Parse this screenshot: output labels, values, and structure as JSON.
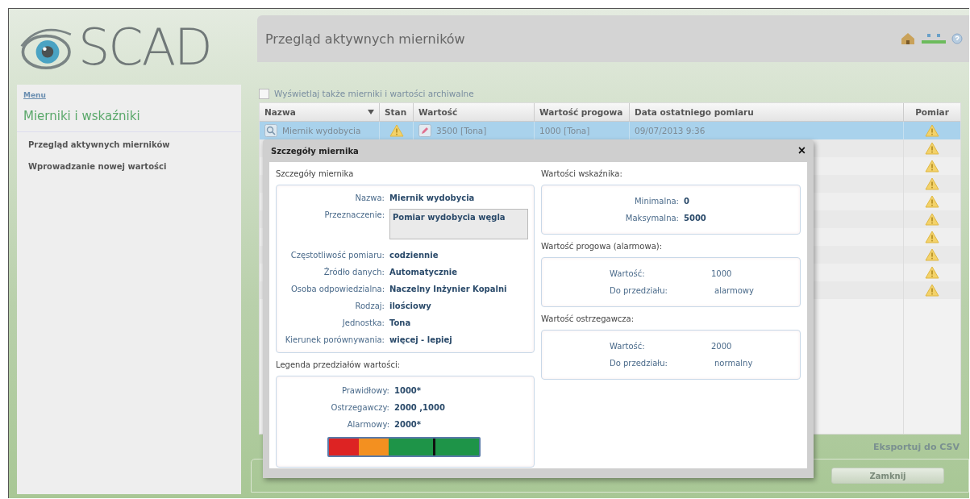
{
  "logo": {
    "text": "SCAD"
  },
  "header": {
    "title": "Przegląd aktywnych mierników"
  },
  "sidebar": {
    "menu_link": "Menu",
    "heading": "Mierniki i wskaźniki",
    "items": [
      {
        "label": "Przegląd aktywnych mierników"
      },
      {
        "label": "Wprowadzanie nowej wartości"
      }
    ]
  },
  "archive_checkbox": {
    "label": "Wyświetlaj także mierniki i wartości archiwalne",
    "checked": false
  },
  "table": {
    "columns": [
      {
        "label": "Nazwa",
        "sortable": true
      },
      {
        "label": "Stan",
        "sortable": false
      },
      {
        "label": "Wartość",
        "sortable": false
      },
      {
        "label": "Wartość progowa",
        "sortable": false
      },
      {
        "label": "Data ostatniego pomiaru",
        "sortable": false
      },
      {
        "label": "Pomiar",
        "sortable": false
      }
    ],
    "rows": [
      {
        "selected": true,
        "name": "Miernik wydobycia",
        "status_warning": true,
        "value": "3500 [Tona]",
        "threshold": "1000 [Tona]",
        "date": "09/07/2013 9:36",
        "measurement_warning": true
      },
      {
        "selected": false,
        "measurement_warning": true
      },
      {
        "selected": false,
        "measurement_warning": true
      },
      {
        "selected": false,
        "measurement_warning": true
      },
      {
        "selected": false,
        "measurement_warning": true
      },
      {
        "selected": false,
        "measurement_warning": true
      },
      {
        "selected": false,
        "measurement_warning": true
      },
      {
        "selected": false,
        "measurement_warning": true
      },
      {
        "selected": false,
        "measurement_warning": true
      },
      {
        "selected": false,
        "measurement_warning": true
      }
    ]
  },
  "export_link": "Eksportuj do CSV",
  "close_button": "Zamknij",
  "dialog": {
    "title": "Szczegóły miernika",
    "close": "×",
    "details_title": "Szczegóły miernika",
    "details": [
      {
        "label": "Nazwa:",
        "value": "Miernik wydobycia",
        "kind": "text"
      },
      {
        "label": "Przeznaczenie:",
        "value": "Pomiar wydobycia węgla",
        "kind": "textarea"
      },
      {
        "label": "Częstotliwość pomiaru:",
        "value": "codziennie",
        "kind": "text"
      },
      {
        "label": "Źródło danych:",
        "value": "Automatycznie",
        "kind": "text"
      },
      {
        "label": "Osoba odpowiedzialna:",
        "value": "Naczelny Inżynier Kopalni",
        "kind": "text"
      },
      {
        "label": "Rodzaj:",
        "value": "ilościowy",
        "kind": "text"
      },
      {
        "label": "Jednostka:",
        "value": "Tona",
        "kind": "text"
      },
      {
        "label": "Kierunek porównywania:",
        "value": "więcej - lepiej",
        "kind": "text"
      }
    ],
    "legend_title": "Legenda przedziałów wartości:",
    "legend": [
      {
        "label": "Prawidłowy:",
        "value": "1000*"
      },
      {
        "label": "Ostrzegawczy:",
        "value": "2000 ,1000"
      },
      {
        "label": "Alarmowy:",
        "value": "2000*"
      }
    ],
    "legend_bar": {
      "segments": [
        {
          "color": "#dd2323"
        },
        {
          "color": "#f39020"
        },
        {
          "color": "#1e9448"
        },
        {
          "color": "#1e9448"
        },
        {
          "color": "#1e9448"
        }
      ],
      "level": 0.7
    },
    "indicator_title": "Wartości wskaźnika:",
    "indicator": [
      {
        "label": "Minimalna:",
        "value": "0"
      },
      {
        "label": "Maksymalna:",
        "value": "5000"
      }
    ],
    "threshold_title": "Wartość progowa (alarmowa):",
    "threshold": [
      {
        "label": "Wartość:",
        "value": "1000"
      },
      {
        "label": "Do przedziału:",
        "value": "alarmowy"
      }
    ],
    "warning_title": "Wartość ostrzegawcza:",
    "warning": [
      {
        "label": "Wartość:",
        "value": "2000"
      },
      {
        "label": "Do przedziału:",
        "value": "normalny"
      }
    ]
  }
}
